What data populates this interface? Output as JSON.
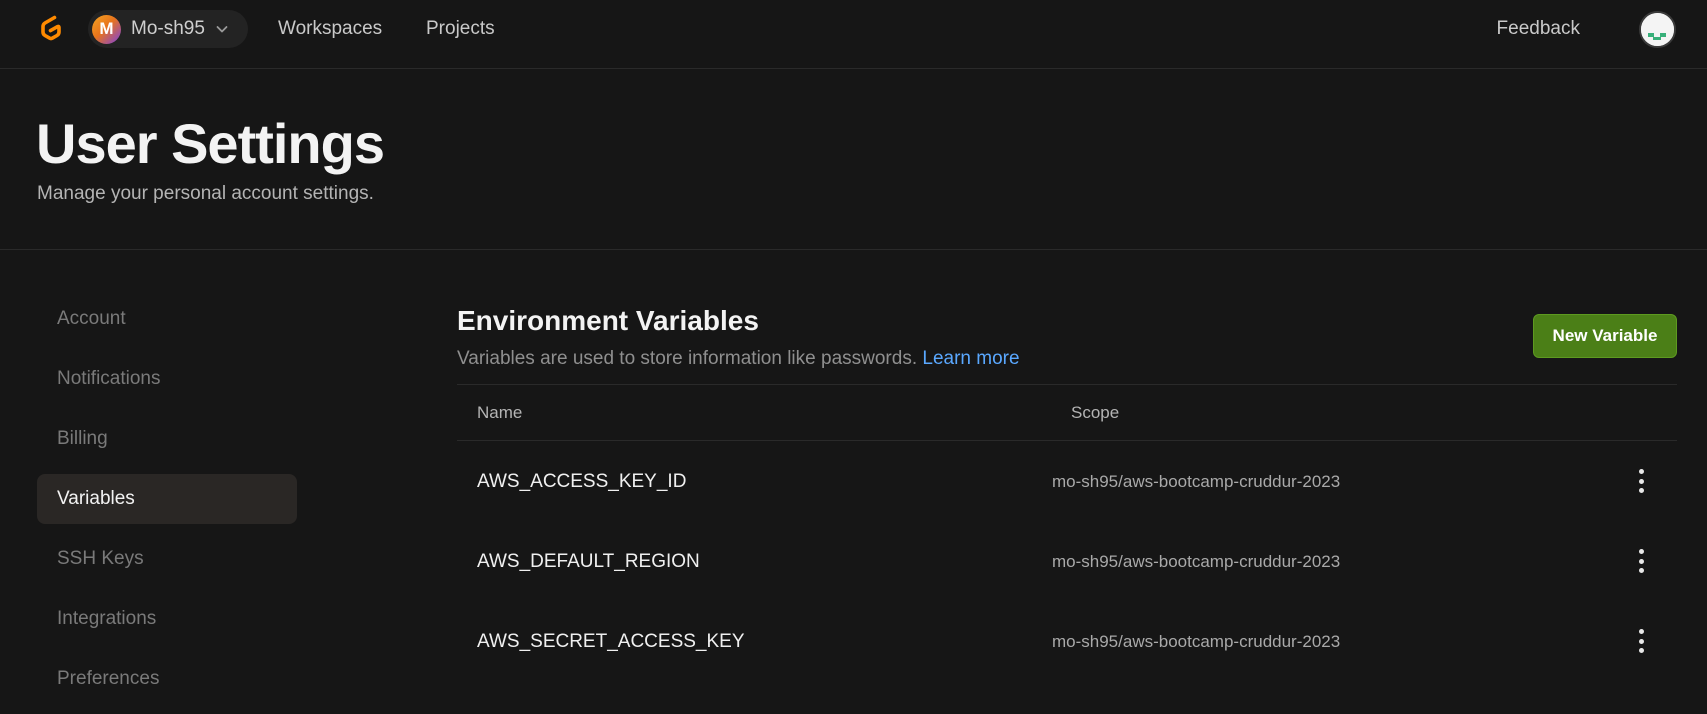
{
  "nav": {
    "logo_icon": "gitpod-logo-icon",
    "org_initial": "M",
    "org_name": "Mo-sh95",
    "links": [
      "Workspaces",
      "Projects"
    ],
    "feedback": "Feedback",
    "user_avatar_icon": "user-avatar-icon"
  },
  "header": {
    "title": "User Settings",
    "subtitle": "Manage your personal account settings."
  },
  "sidebar": {
    "items": [
      {
        "label": "Account"
      },
      {
        "label": "Notifications"
      },
      {
        "label": "Billing"
      },
      {
        "label": "Variables",
        "active": true
      },
      {
        "label": "SSH Keys"
      },
      {
        "label": "Integrations"
      },
      {
        "label": "Preferences"
      }
    ]
  },
  "main": {
    "title": "Environment Variables",
    "description": "Variables are used to store information like passwords.",
    "learn_more": "Learn more",
    "new_button": "New Variable",
    "columns": {
      "name": "Name",
      "scope": "Scope"
    },
    "rows": [
      {
        "name": "AWS_ACCESS_KEY_ID",
        "scope": "mo-sh95/aws-bootcamp-cruddur-2023"
      },
      {
        "name": "AWS_DEFAULT_REGION",
        "scope": "mo-sh95/aws-bootcamp-cruddur-2023"
      },
      {
        "name": "AWS_SECRET_ACCESS_KEY",
        "scope": "mo-sh95/aws-bootcamp-cruddur-2023"
      }
    ]
  },
  "colors": {
    "accent_green": "#4b7f17",
    "link_blue": "#5aa8ff",
    "logo_orange": "#ff8a00"
  }
}
